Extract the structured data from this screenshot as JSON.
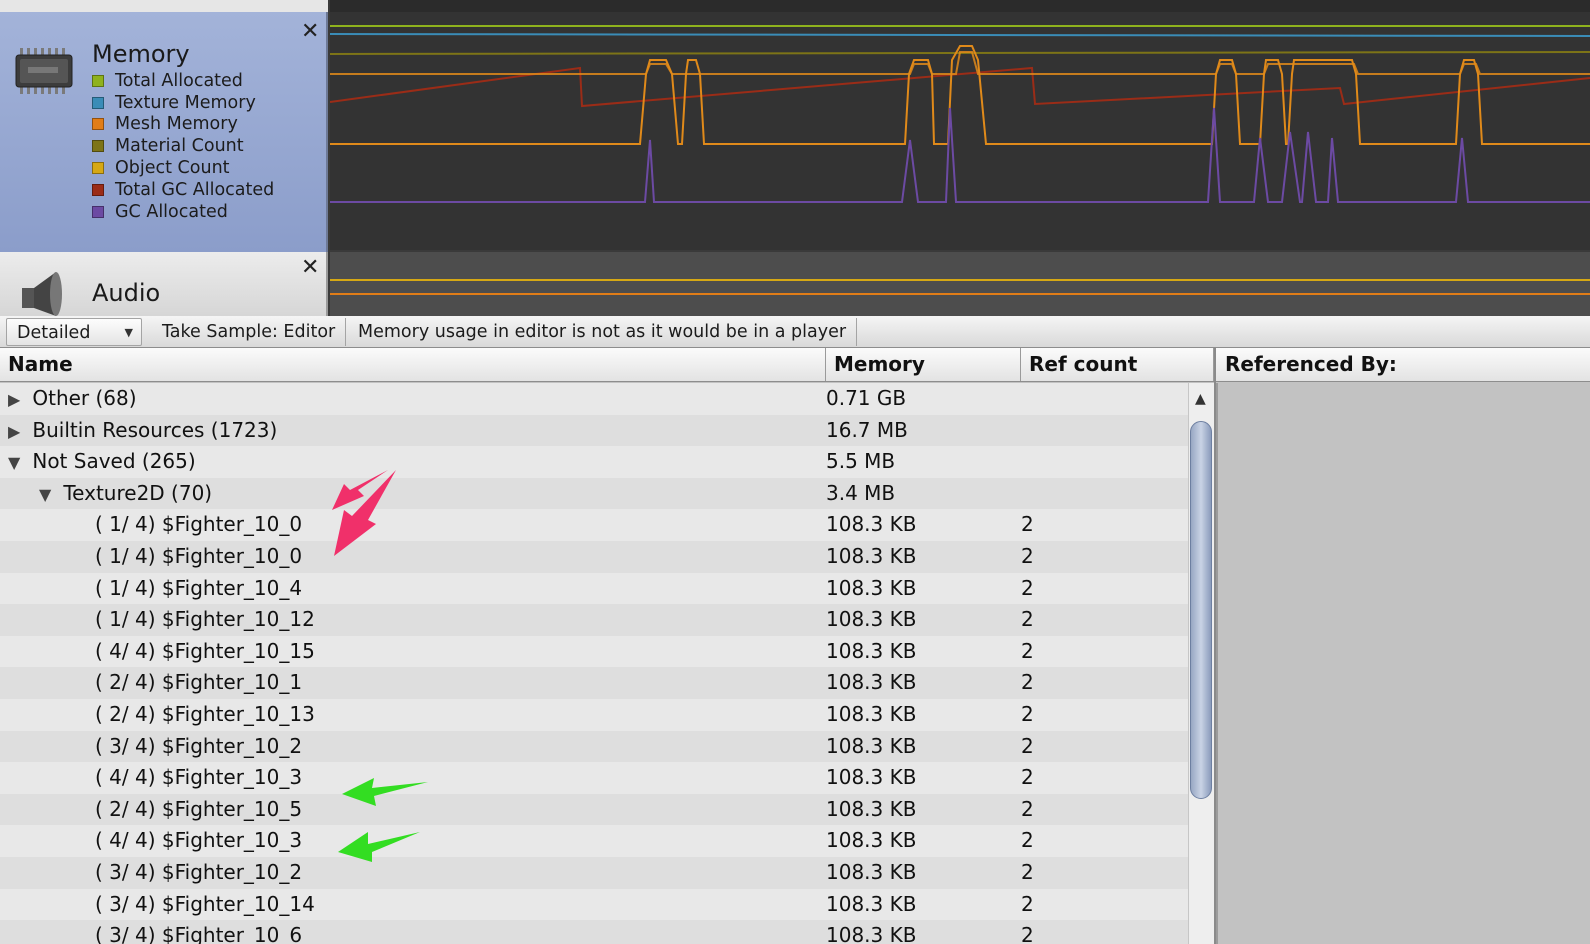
{
  "memory_panel": {
    "title": "Memory",
    "legend": [
      {
        "label": "Total Allocated",
        "color": "#8fb21d"
      },
      {
        "label": "Texture Memory",
        "color": "#3a8cb7"
      },
      {
        "label": "Mesh Memory",
        "color": "#e17d17"
      },
      {
        "label": "Material Count",
        "color": "#7d7417"
      },
      {
        "label": "Object Count",
        "color": "#d6a814"
      },
      {
        "label": "Total GC Allocated",
        "color": "#9b2c17"
      },
      {
        "label": "GC Allocated",
        "color": "#6c4aa3"
      }
    ]
  },
  "audio_panel": {
    "title": "Audio"
  },
  "toolbar": {
    "view_mode": "Detailed",
    "take_sample": "Take Sample: Editor",
    "notice": "Memory usage in editor is not as it would be in a player"
  },
  "table": {
    "columns": {
      "name": "Name",
      "memory": "Memory",
      "ref_count": "Ref count",
      "referenced_by": "Referenced By:"
    },
    "rows": [
      {
        "name": "Other (68)",
        "memory": "0.71 GB",
        "ref": "",
        "level": 0,
        "expander": "collapsed"
      },
      {
        "name": "Builtin Resources (1723)",
        "memory": "16.7 MB",
        "ref": "",
        "level": 0,
        "expander": "collapsed"
      },
      {
        "name": "Not Saved (265)",
        "memory": "5.5 MB",
        "ref": "",
        "level": 0,
        "expander": "expanded"
      },
      {
        "name": "Texture2D (70)",
        "memory": "3.4 MB",
        "ref": "",
        "level": 1,
        "expander": "expanded"
      },
      {
        "name": "( 1/ 4) $Fighter_10_0",
        "memory": "108.3 KB",
        "ref": "2",
        "level": 2,
        "expander": "none"
      },
      {
        "name": "( 1/ 4) $Fighter_10_0",
        "memory": "108.3 KB",
        "ref": "2",
        "level": 2,
        "expander": "none"
      },
      {
        "name": "( 1/ 4) $Fighter_10_4",
        "memory": "108.3 KB",
        "ref": "2",
        "level": 2,
        "expander": "none"
      },
      {
        "name": "( 1/ 4) $Fighter_10_12",
        "memory": "108.3 KB",
        "ref": "2",
        "level": 2,
        "expander": "none"
      },
      {
        "name": "( 4/ 4) $Fighter_10_15",
        "memory": "108.3 KB",
        "ref": "2",
        "level": 2,
        "expander": "none"
      },
      {
        "name": "( 2/ 4) $Fighter_10_1",
        "memory": "108.3 KB",
        "ref": "2",
        "level": 2,
        "expander": "none"
      },
      {
        "name": "( 2/ 4) $Fighter_10_13",
        "memory": "108.3 KB",
        "ref": "2",
        "level": 2,
        "expander": "none"
      },
      {
        "name": "( 3/ 4) $Fighter_10_2",
        "memory": "108.3 KB",
        "ref": "2",
        "level": 2,
        "expander": "none"
      },
      {
        "name": "( 4/ 4) $Fighter_10_3",
        "memory": "108.3 KB",
        "ref": "2",
        "level": 2,
        "expander": "none"
      },
      {
        "name": "( 2/ 4) $Fighter_10_5",
        "memory": "108.3 KB",
        "ref": "2",
        "level": 2,
        "expander": "none"
      },
      {
        "name": "( 4/ 4) $Fighter_10_3",
        "memory": "108.3 KB",
        "ref": "2",
        "level": 2,
        "expander": "none"
      },
      {
        "name": "( 3/ 4) $Fighter_10_2",
        "memory": "108.3 KB",
        "ref": "2",
        "level": 2,
        "expander": "none"
      },
      {
        "name": "( 3/ 4) $Fighter_10_14",
        "memory": "108.3 KB",
        "ref": "2",
        "level": 2,
        "expander": "none"
      },
      {
        "name": "( 3/ 4) $Fighter_10_6",
        "memory": "108.3 KB",
        "ref": "2",
        "level": 2,
        "expander": "none"
      }
    ]
  },
  "annotations": {
    "pink_arrow_color": "#f0306a",
    "green_arrow_color": "#33dd22"
  }
}
